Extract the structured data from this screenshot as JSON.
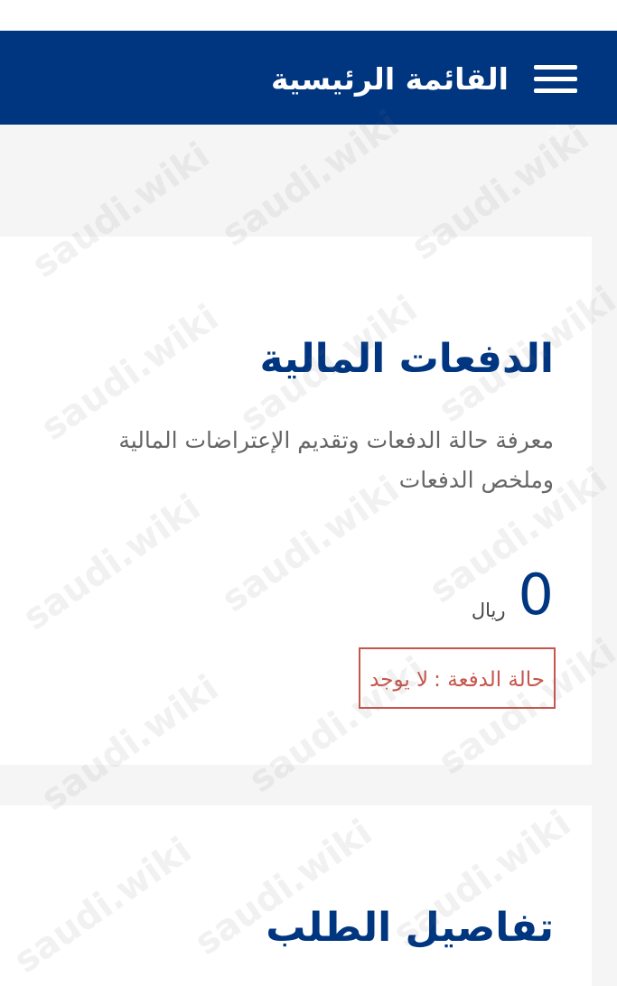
{
  "header": {
    "title": "القائمة الرئيسية",
    "menu_icon": "hamburger-menu-icon",
    "background_color": "#003580"
  },
  "payments_card": {
    "title": "الدفعات المالية",
    "description": "معرفة حالة الدفعات وتقديم الإعتراضات المالية وملخص الدفعات",
    "amount": "0",
    "currency": "ريال",
    "status_label": "حالة الدفعة :",
    "status_value": "لا يوجد",
    "status_color": "#c6554b"
  },
  "details_card": {
    "title": "تفاصيل الطلب"
  },
  "watermark": {
    "text": "saudi.wiki"
  }
}
